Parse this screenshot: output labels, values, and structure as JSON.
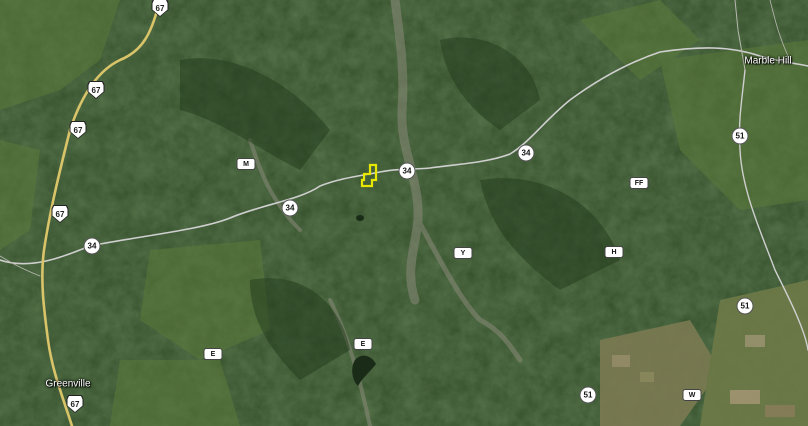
{
  "map": {
    "colors": {
      "forest": "#2f4a26",
      "forest_dark": "#223a1c",
      "field": "#5b7a3a",
      "farmland": "#7b7a52",
      "valley": "#8a8a78",
      "road": "#cfcfcf",
      "highway": "#d9c46a",
      "parcel": "#e6e600"
    },
    "towns": [
      {
        "id": "marble-hill",
        "name": "Marble Hill"
      },
      {
        "id": "greenville",
        "name": "Greenville"
      }
    ],
    "us_routes": [
      {
        "id": "us67-a",
        "label": "67"
      },
      {
        "id": "us67-b",
        "label": "67"
      },
      {
        "id": "us67-c",
        "label": "67"
      },
      {
        "id": "us67-d",
        "label": "67"
      },
      {
        "id": "us67-e",
        "label": "67"
      }
    ],
    "state_routes": [
      {
        "id": "sr34-a",
        "label": "34"
      },
      {
        "id": "sr34-b",
        "label": "34"
      },
      {
        "id": "sr34-c",
        "label": "34"
      },
      {
        "id": "sr34-d",
        "label": "34"
      },
      {
        "id": "sr51-a",
        "label": "51"
      },
      {
        "id": "sr51-b",
        "label": "51"
      },
      {
        "id": "sr51-c",
        "label": "51"
      }
    ],
    "county_routes": [
      {
        "id": "m",
        "label": "M"
      },
      {
        "id": "ff",
        "label": "FF"
      },
      {
        "id": "y",
        "label": "Y"
      },
      {
        "id": "h",
        "label": "H"
      },
      {
        "id": "e-a",
        "label": "E"
      },
      {
        "id": "e-b",
        "label": "E"
      },
      {
        "id": "w",
        "label": "W"
      }
    ],
    "parcel": {
      "highlight_color": "#e6e600"
    }
  }
}
